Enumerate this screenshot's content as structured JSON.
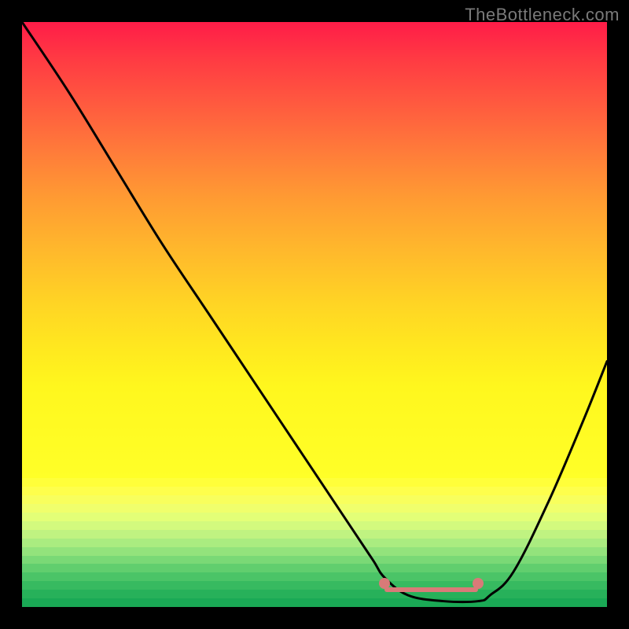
{
  "watermark": "TheBottleneck.com",
  "chart_data": {
    "type": "line",
    "title": "",
    "xlabel": "",
    "ylabel": "",
    "xlim": [
      0,
      100
    ],
    "ylim": [
      0,
      100
    ],
    "series": [
      {
        "name": "bottleneck-curve",
        "x": [
          0,
          8,
          16,
          24,
          32,
          40,
          48,
          56,
          60,
          62,
          66,
          72,
          78,
          80,
          84,
          90,
          96,
          100
        ],
        "y": [
          100,
          88,
          75,
          62,
          50,
          38,
          26,
          14,
          8,
          5,
          2,
          1,
          1,
          2,
          6,
          18,
          32,
          42
        ]
      }
    ],
    "markers": {
      "left": {
        "x": 62,
        "y": 4
      },
      "right": {
        "x": 78,
        "y": 4
      }
    },
    "flat_segment": {
      "x_start": 62,
      "x_end": 78,
      "y": 3
    },
    "gradient_stops": [
      {
        "pct": 0,
        "color": "#ff1c48"
      },
      {
        "pct": 40,
        "color": "#ff9933"
      },
      {
        "pct": 70,
        "color": "#ffe91f"
      },
      {
        "pct": 82,
        "color": "#ffff55"
      },
      {
        "pct": 86,
        "color": "#f6ff7a"
      },
      {
        "pct": 90,
        "color": "#d4ff8a"
      },
      {
        "pct": 94,
        "color": "#9fef82"
      },
      {
        "pct": 98,
        "color": "#4fd36a"
      },
      {
        "pct": 100,
        "color": "#1db856"
      }
    ]
  }
}
